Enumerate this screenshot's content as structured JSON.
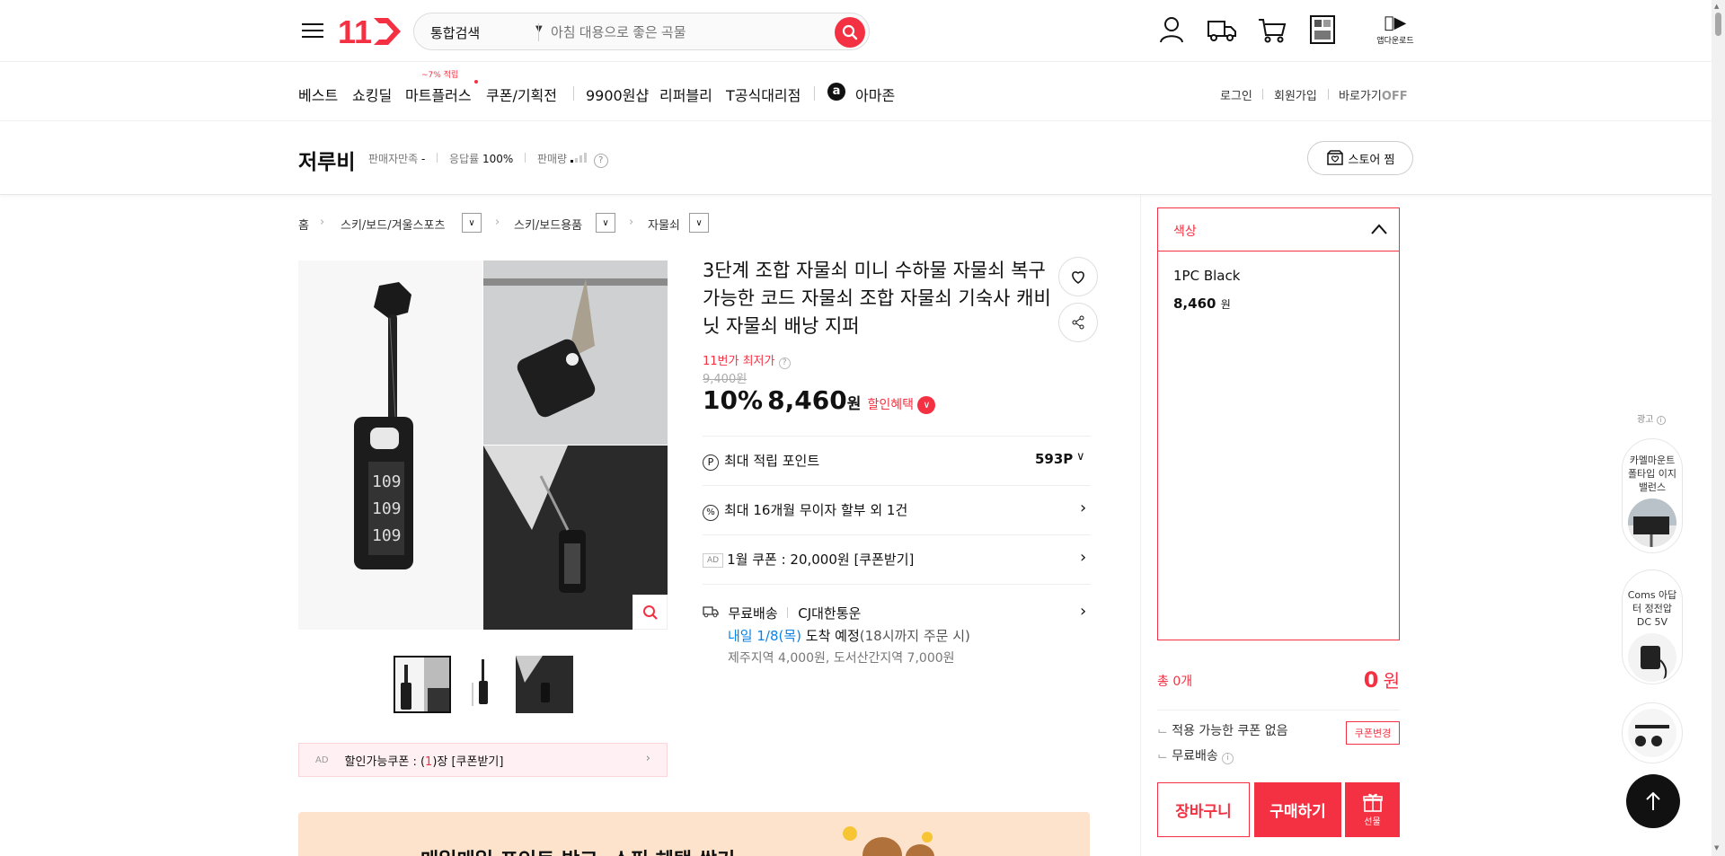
{
  "header": {
    "logo": "11",
    "search_scope": "통합검색",
    "search_placeholder": "아침 대용으로 좋은 곡물",
    "app_download": "앱다운로드"
  },
  "nav": {
    "items": [
      "베스트",
      "쇼킹딜",
      "마트플러스",
      "쿠폰/기획전",
      "9900원샵",
      "리퍼블리",
      "T공식대리점",
      "아마존"
    ],
    "mart_badge": "~7% 적립",
    "login": "로그인",
    "signup": "회원가입",
    "shortcut": "바로가기",
    "shortcut_state": "OFF"
  },
  "store": {
    "name": "저루비",
    "satisfaction_label": "판매자만족",
    "satisfaction_value": "-",
    "response_label": "응답률",
    "response_value": "100%",
    "sales_label": "판매량",
    "favorite_button": "스토어 찜"
  },
  "breadcrumb": [
    "홈",
    "스키/보드/겨울스포츠",
    "스키/보드용품",
    "자물쇠"
  ],
  "product": {
    "title": "3단계 조합 자물쇠 미니 수하물 자물쇠 복구 가능한 코드 자물쇠 조합 자물쇠 기숙사 캐비닛 자물쇠 배낭 지퍼",
    "lowest_label": "11번가 최저가",
    "original_price": "9,400원",
    "discount": "10%",
    "price": "8,460",
    "price_unit": "원",
    "discount_benefit": "할인혜택",
    "points_label": "최대 적립 포인트",
    "points_value": "593P",
    "installment": "최대 16개월 무이자 할부 외 1건",
    "ad_tag": "AD",
    "coupon_text": "1월 쿠폰 : 20,000원 [쿠폰받기]",
    "shipping_label": "무료배송",
    "carrier": "CJ대한통운",
    "arrival_date": "내일 1/8(목)",
    "arrival_text": "도착 예정",
    "arrival_note": "(18시까지 주문 시)",
    "extra_fee": "제주지역 4,000원, 도서산간지역 7,000원",
    "coupon_banner_ad": "AD",
    "coupon_banner_prefix": "할인가능쿠폰 : (",
    "coupon_banner_count": "1",
    "coupon_banner_suffix": ")장 [쿠폰받기]",
    "promo_banner": "매일매일 포인트 받고, 쇼핑 혜택 쌓기"
  },
  "options": {
    "header": "색상",
    "item_name": "1PC Black",
    "item_price": "8,460",
    "item_unit": "원",
    "total_label": "총 0개",
    "total_price": "0",
    "total_unit": "원",
    "coupon_none": "적용 가능한 쿠폰 없음",
    "coupon_change": "쿠폰변경",
    "free_shipping": "무료배송",
    "cart_button": "장바구니",
    "buy_button": "구매하기",
    "gift_button": "선물"
  },
  "side_ads": {
    "label": "광고",
    "items": [
      "카멜마운트 폴타입 이지밸런스",
      "Coms 아답터 정전압 DC 5V"
    ]
  },
  "colors": {
    "brand": "#f43142",
    "link_blue": "#0b83e6"
  }
}
